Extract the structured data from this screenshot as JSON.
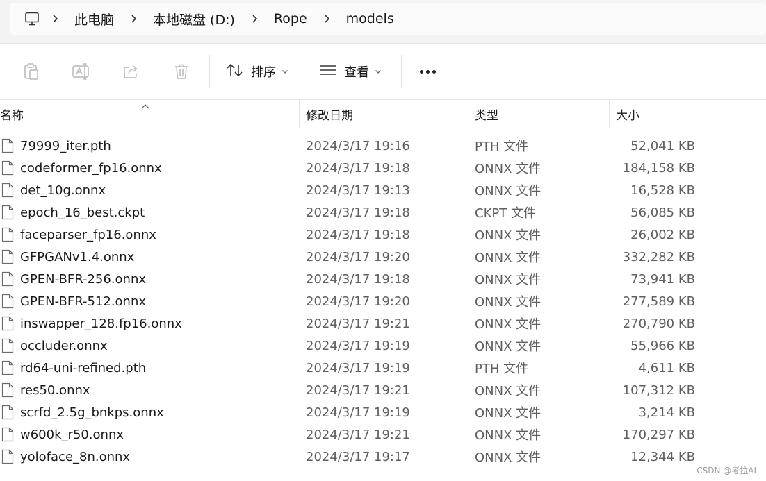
{
  "breadcrumb": [
    "此电脑",
    "本地磁盘 (D:)",
    "Rope",
    "models"
  ],
  "toolbar": {
    "sort_label": "排序",
    "view_label": "查看"
  },
  "columns": {
    "name": "名称",
    "date": "修改日期",
    "type": "类型",
    "size": "大小"
  },
  "files": [
    {
      "name": "79999_iter.pth",
      "date": "2024/3/17 19:16",
      "type": "PTH 文件",
      "size": "52,041 KB"
    },
    {
      "name": "codeformer_fp16.onnx",
      "date": "2024/3/17 19:18",
      "type": "ONNX 文件",
      "size": "184,158 KB"
    },
    {
      "name": "det_10g.onnx",
      "date": "2024/3/17 19:13",
      "type": "ONNX 文件",
      "size": "16,528 KB"
    },
    {
      "name": "epoch_16_best.ckpt",
      "date": "2024/3/17 19:18",
      "type": "CKPT 文件",
      "size": "56,085 KB"
    },
    {
      "name": "faceparser_fp16.onnx",
      "date": "2024/3/17 19:18",
      "type": "ONNX 文件",
      "size": "26,002 KB"
    },
    {
      "name": "GFPGANv1.4.onnx",
      "date": "2024/3/17 19:20",
      "type": "ONNX 文件",
      "size": "332,282 KB"
    },
    {
      "name": "GPEN-BFR-256.onnx",
      "date": "2024/3/17 19:18",
      "type": "ONNX 文件",
      "size": "73,941 KB"
    },
    {
      "name": "GPEN-BFR-512.onnx",
      "date": "2024/3/17 19:20",
      "type": "ONNX 文件",
      "size": "277,589 KB"
    },
    {
      "name": "inswapper_128.fp16.onnx",
      "date": "2024/3/17 19:21",
      "type": "ONNX 文件",
      "size": "270,790 KB"
    },
    {
      "name": "occluder.onnx",
      "date": "2024/3/17 19:19",
      "type": "ONNX 文件",
      "size": "55,966 KB"
    },
    {
      "name": "rd64-uni-refined.pth",
      "date": "2024/3/17 19:19",
      "type": "PTH 文件",
      "size": "4,611 KB"
    },
    {
      "name": "res50.onnx",
      "date": "2024/3/17 19:21",
      "type": "ONNX 文件",
      "size": "107,312 KB"
    },
    {
      "name": "scrfd_2.5g_bnkps.onnx",
      "date": "2024/3/17 19:19",
      "type": "ONNX 文件",
      "size": "3,214 KB"
    },
    {
      "name": "w600k_r50.onnx",
      "date": "2024/3/17 19:21",
      "type": "ONNX 文件",
      "size": "170,297 KB"
    },
    {
      "name": "yoloface_8n.onnx",
      "date": "2024/3/17 19:17",
      "type": "ONNX 文件",
      "size": "12,344 KB"
    }
  ],
  "watermark": "CSDN @考拉AI"
}
